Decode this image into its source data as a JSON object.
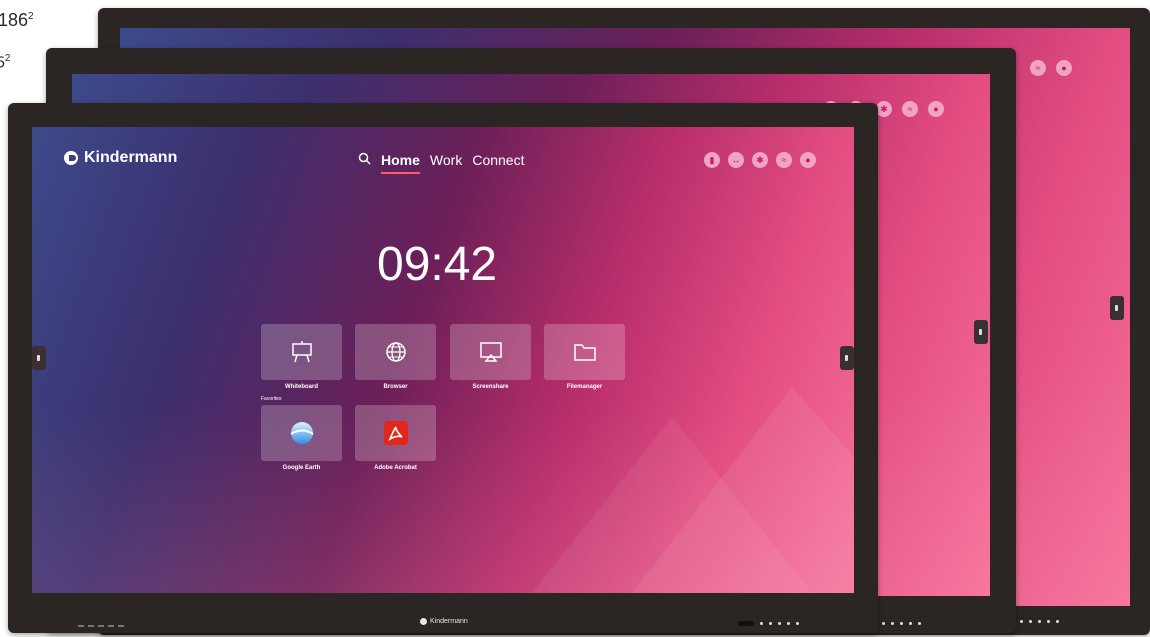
{
  "page_labels": {
    "top": {
      "text": "186",
      "sup": "2"
    },
    "second": {
      "text": "5",
      "sup": "2"
    }
  },
  "screen": {
    "brand": "Kindermann",
    "nav": {
      "search_icon": "search-icon",
      "items": [
        {
          "label": "Home",
          "active": true
        },
        {
          "label": "Work",
          "active": false
        },
        {
          "label": "Connect",
          "active": false
        }
      ]
    },
    "status_icons": [
      "usb-icon",
      "input-icon",
      "bluetooth-icon",
      "wifi-icon",
      "hotspot-icon"
    ],
    "clock": "09:42",
    "apps": [
      {
        "label": "Whiteboard",
        "icon": "whiteboard-icon"
      },
      {
        "label": "Browser",
        "icon": "globe-icon"
      },
      {
        "label": "Screenshare",
        "icon": "screenshare-icon"
      },
      {
        "label": "Filemanager",
        "icon": "folder-icon"
      }
    ],
    "favorites_label": "Favorites",
    "favorites": [
      {
        "label": "Google Earth",
        "icon": "google-earth-icon"
      },
      {
        "label": "Adobe Acrobat",
        "icon": "adobe-acrobat-icon"
      }
    ]
  },
  "bezel": {
    "brand": "Kindermann"
  },
  "colors": {
    "bezel": "#2b2523",
    "accent_underline": "#ff5a6e",
    "status_icon_bg": "#f0a3c4",
    "acrobat_red": "#e1271c"
  }
}
